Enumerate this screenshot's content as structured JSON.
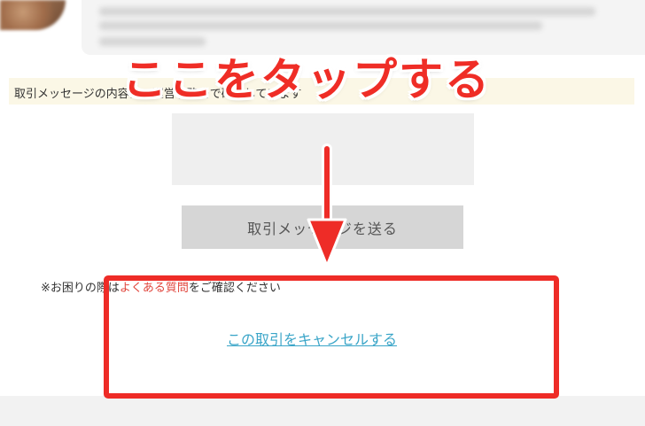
{
  "notice": {
    "text": "取引メッセージの内容は、運営事務局で確認しています"
  },
  "composer": {
    "send_label": "取引メッセージを送る"
  },
  "help": {
    "prefix": "※お困りの際は",
    "faq_link": "よくある質問",
    "suffix": "をご確認ください"
  },
  "cancel": {
    "link_text": "この取引をキャンセルする"
  },
  "annotation": {
    "callout": "ここをタップする",
    "color": "#ee2c27"
  },
  "colors": {
    "link": "#3aa5c8",
    "faq": "#e0453c",
    "notice_bg": "#fbf7e6"
  }
}
